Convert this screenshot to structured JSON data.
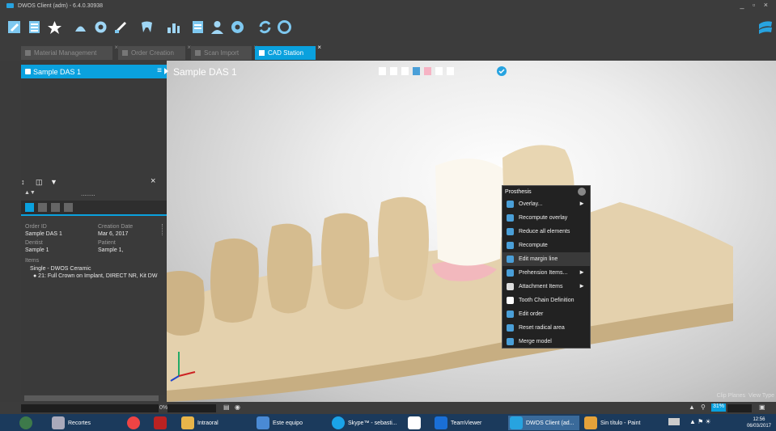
{
  "window": {
    "title": "DWOS Client (adm) - 6.4.0.30938",
    "controls": "_ ▫ ×"
  },
  "toolbar": {
    "icons": [
      "edit-icon",
      "list-icon",
      "star-icon",
      "scan-icon",
      "gear-flower-icon",
      "check-arrow-icon",
      "tooth-icon",
      "chart-icon",
      "document-icon",
      "person-icon",
      "settings-icon",
      "sync-icon",
      "lifebuoy-icon"
    ]
  },
  "tabs": [
    {
      "label": "Material Management",
      "active": false
    },
    {
      "label": "Order Creation",
      "active": false
    },
    {
      "label": "Scan Import",
      "active": false
    },
    {
      "label": "CAD Station",
      "active": true
    }
  ],
  "left_panel": {
    "header": "Sample DAS 1",
    "order_id_label": "Order ID",
    "order_id": "Sample DAS 1",
    "creation_date_label": "Creation Date",
    "creation_date": "Mar 6, 2017",
    "dentist_label": "Dentist",
    "dentist": "Sample 1",
    "patient_label": "Patient",
    "patient": "Sample 1,",
    "items_label": "Items",
    "item_group": "Single - DWOS Ceramic",
    "item_detail": "● 21: Full Crown on Implant, DIRECT NR, Kit DW",
    "dotted": "........"
  },
  "viewport": {
    "title": "Sample DAS 1"
  },
  "context_menu": {
    "header": "Prosthesis",
    "items": [
      {
        "label": "Overlay...",
        "submenu": true
      },
      {
        "label": "Recompute overlay",
        "submenu": false
      },
      {
        "label": "Reduce all elements",
        "submenu": false
      },
      {
        "label": "Recompute",
        "submenu": false
      },
      {
        "label": "Edit margin line",
        "submenu": false
      },
      {
        "label": "Prehension Items...",
        "submenu": true
      },
      {
        "label": "Attachment Items",
        "submenu": true
      },
      {
        "label": "Tooth Chain Definition",
        "submenu": false
      },
      {
        "label": "Edit order",
        "submenu": false
      },
      {
        "label": "Reset radical area",
        "submenu": false
      },
      {
        "label": "Merge model",
        "submenu": false
      }
    ]
  },
  "clip": {
    "clip_planes": "Clip Planes",
    "view_type": "View Type"
  },
  "bottom": {
    "percent": "0%",
    "zoom": "31%"
  },
  "taskbar": {
    "items": [
      {
        "label": "Recortes"
      },
      {
        "label": ""
      },
      {
        "label": ""
      },
      {
        "label": "Intraoral"
      },
      {
        "label": "Este equipo"
      },
      {
        "label": "Skype™ - sebasti..."
      },
      {
        "label": ""
      },
      {
        "label": "TeamViewer"
      },
      {
        "label": "DWOS Client (ad..."
      },
      {
        "label": "Sin título - Paint"
      }
    ],
    "time": "12:56",
    "date": "06/03/2017"
  }
}
